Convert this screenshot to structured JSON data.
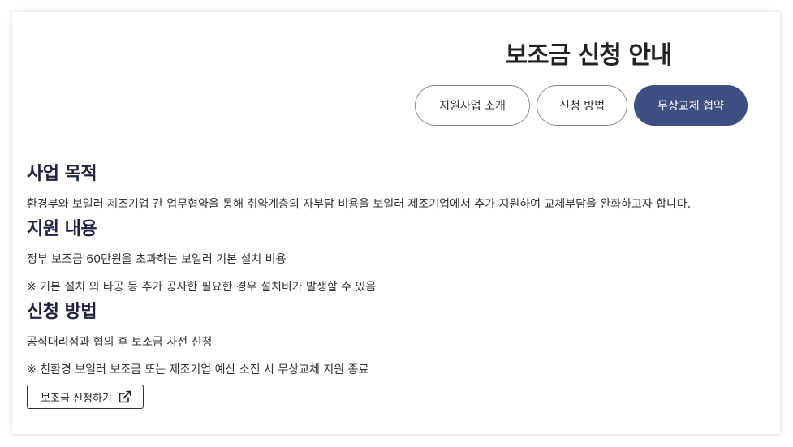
{
  "page": {
    "title": "보조금 신청 안내"
  },
  "tabs": [
    {
      "label": "지원사업 소개",
      "active": false
    },
    {
      "label": "신청 방법",
      "active": false
    },
    {
      "label": "무상교체 협약",
      "active": true
    }
  ],
  "sections": {
    "purpose": {
      "heading": "사업 목적",
      "text": "환경부와 보일러 제조기업 간 업무협약을 통해 취약계층의 자부담 비용을 보일러 제조기업에서 추가 지원하여 교체부담을 완화하고자 합니다."
    },
    "support": {
      "heading": "지원 내용",
      "text": "정부 보조금 60만원을 초과하는 보일러 기본 설치 비용",
      "note": "※ 기본 설치 외 타공 등 추가 공사한 필요한 경우 설치비가 발생할 수 있음"
    },
    "apply": {
      "heading": "신청 방법",
      "text": "공식대리점과 협의 후 보조금 사전 신청",
      "note": "※ 친환경 보일러 보조금 또는 제조기업 예산 소진 시 무상교체 지원 종료",
      "button_label": "보조금 신청하기",
      "button_icon": "external-link-icon"
    }
  },
  "colors": {
    "accent": "#3f4e80",
    "heading": "#1e2340"
  }
}
